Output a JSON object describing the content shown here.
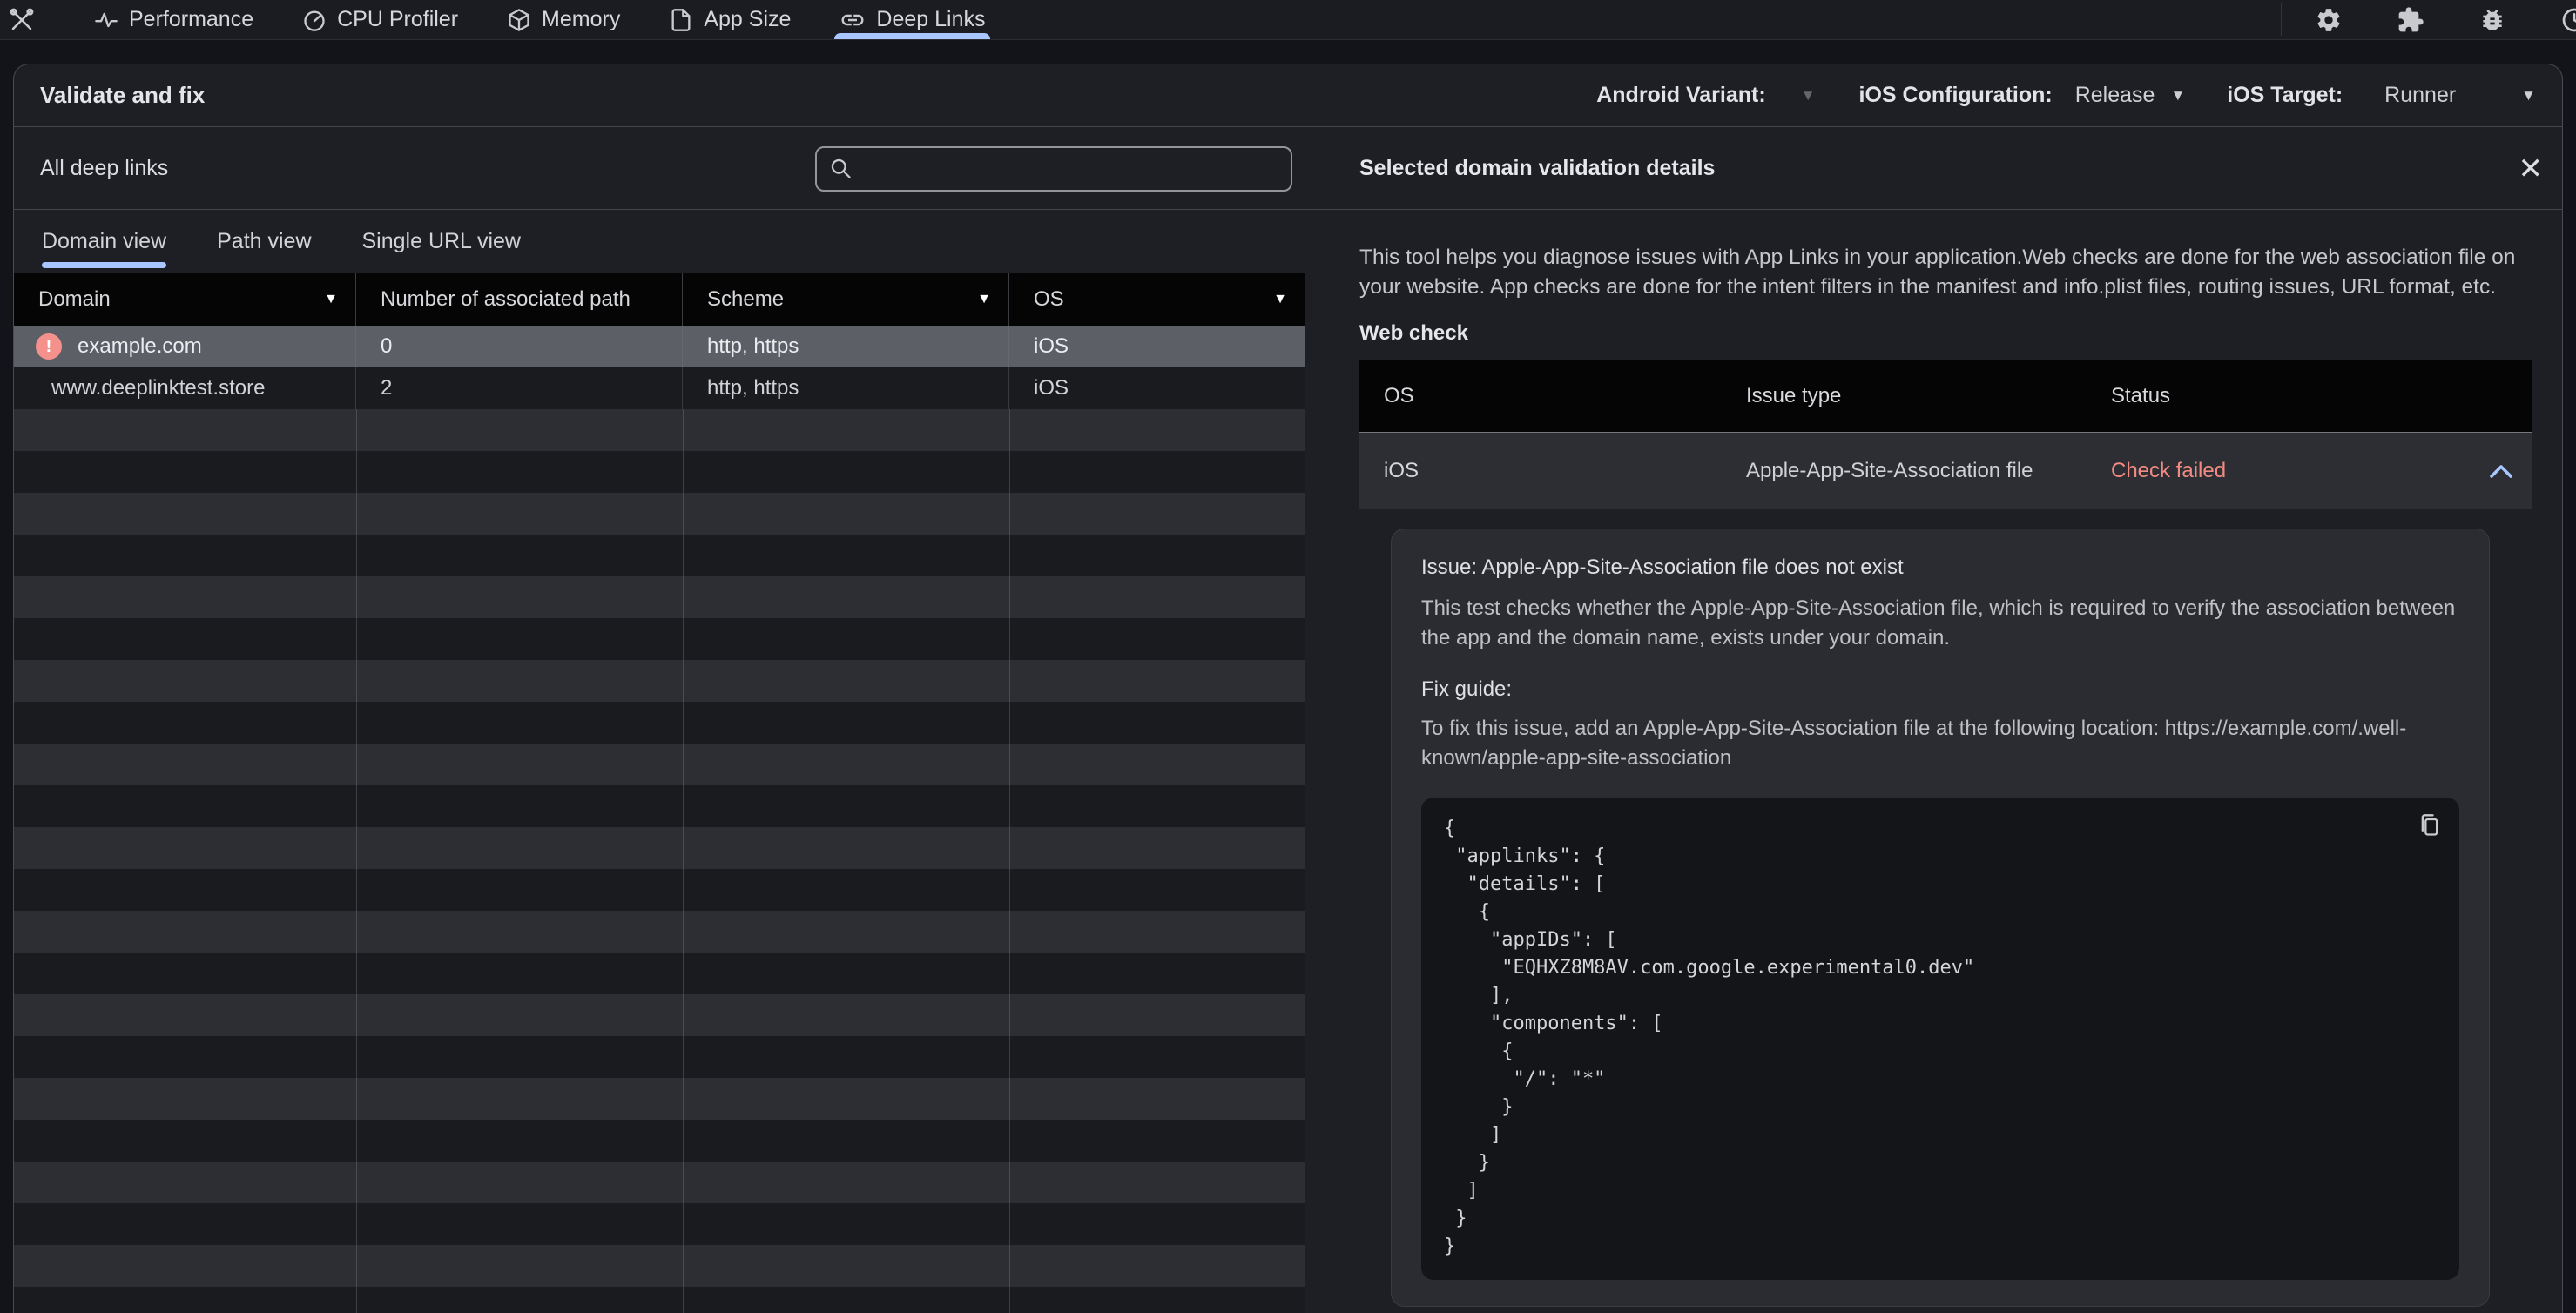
{
  "toolbar": {
    "tabs": [
      {
        "label": "Performance",
        "icon": "performance-icon",
        "active": false
      },
      {
        "label": "CPU Profiler",
        "icon": "cpu-profiler-icon",
        "active": false
      },
      {
        "label": "Memory",
        "icon": "memory-icon",
        "active": false
      },
      {
        "label": "App Size",
        "icon": "app-size-icon",
        "active": false
      },
      {
        "label": "Deep Links",
        "icon": "deep-links-icon",
        "active": true
      }
    ],
    "right_icons": [
      "settings-icon",
      "extensions-icon",
      "bug-icon",
      "about-icon"
    ]
  },
  "header": {
    "title": "Validate and fix",
    "android_variant_label": "Android Variant:",
    "ios_configuration_label": "iOS Configuration:",
    "ios_configuration_value": "Release",
    "ios_target_label": "iOS Target:",
    "ios_target_value": "Runner"
  },
  "left_panel": {
    "title": "All deep links",
    "search_placeholder": "",
    "search_value": "",
    "view_tabs": [
      "Domain view",
      "Path view",
      "Single URL view"
    ],
    "active_view_tab": "Domain view",
    "table": {
      "columns": [
        "Domain",
        "Number of associated path",
        "Scheme",
        "OS"
      ],
      "rows": [
        {
          "domain": "example.com",
          "paths": "0",
          "scheme": "http, https",
          "os": "iOS"
        },
        {
          "domain": "www.deeplinktest.store",
          "paths": "2",
          "scheme": "http, https",
          "os": "iOS"
        }
      ]
    }
  },
  "right_panel": {
    "title": "Selected domain validation details",
    "description": "This tool helps you diagnose issues with App Links in your application.Web checks are done for the web association file on your website. App checks are done for the intent filters in the manifest and info.plist files, routing issues, URL format, etc.",
    "web_check_title": "Web check",
    "table": {
      "columns": [
        "OS",
        "Issue type",
        "Status"
      ]
    },
    "issue_row": {
      "os": "iOS",
      "issue_type": "Apple-App-Site-Association file",
      "status": "Check failed"
    },
    "issue_detail": {
      "title": "Issue: Apple-App-Site-Association file does not exist",
      "description": "This test checks whether the Apple-App-Site-Association file, which is required to verify the association between the app and the domain name, exists under your domain.",
      "fix_guide_label": "Fix guide:",
      "fix_guide_text": "To fix this issue, add an Apple-App-Site-Association file at the following location: https://example.com/.well-known/apple-app-site-association",
      "code": "{\n \"applinks\": {\n  \"details\": [\n   {\n    \"appIDs\": [\n     \"EQHXZ8M8AV.com.google.experimental0.dev\"\n    ],\n    \"components\": [\n     {\n      \"/\": \"*\"\n     }\n    ]\n   }\n  ]\n }\n}"
    }
  },
  "colors": {
    "accent": "#a9c7ff",
    "error": "#f28b82",
    "selected_row": "#5c5f66"
  }
}
